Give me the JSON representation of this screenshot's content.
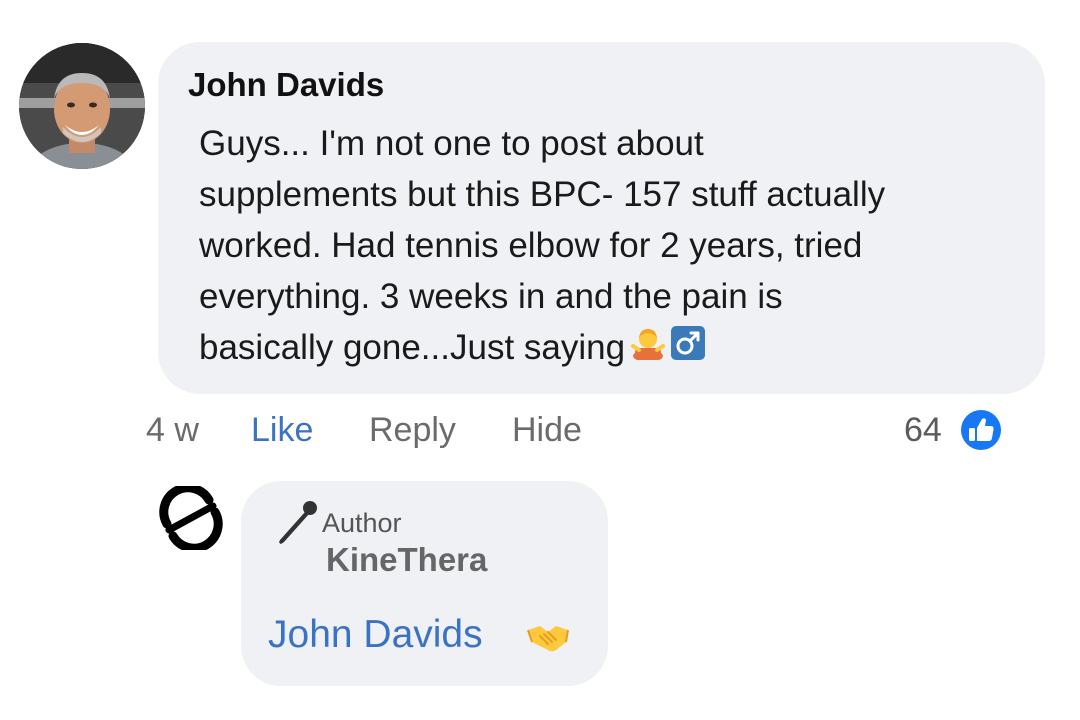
{
  "comment": {
    "author": "John Davids",
    "text_lines": [
      "Guys... I'm not one to post about",
      "supplements but this BPC- 157 stuff actually",
      "worked. Had tennis elbow for 2 years, tried",
      "everything. 3 weeks in and the pain is",
      "basically gone...Just saying"
    ],
    "trailing_emoji": [
      "person-shrugging-emoji",
      "male-sign-emoji"
    ],
    "avatar_icon": "user-avatar-photo"
  },
  "actions": {
    "time": "4 w",
    "like": "Like",
    "reply": "Reply",
    "hide": "Hide",
    "reaction_count": "64",
    "reaction_icon": "thumbs-up-icon"
  },
  "reply": {
    "avatar_icon": "kinethera-logo",
    "badge_icon": "microphone-icon",
    "badge_label": "Author",
    "author": "KineThera",
    "mention": "John Davids",
    "trailing_emoji": "handshake-emoji"
  },
  "colors": {
    "bubble_bg": "#f0f1f4",
    "link_blue": "#3b73c4",
    "like_badge_blue": "#1877f2",
    "muted_text": "#6b6b6b"
  }
}
